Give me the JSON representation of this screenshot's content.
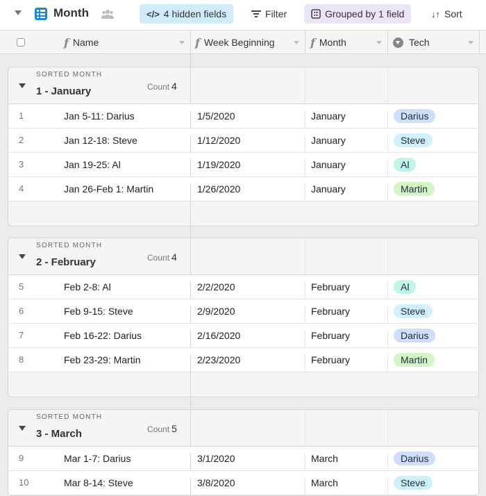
{
  "toolbar": {
    "view_name": "Month",
    "hidden_fields_label": "4 hidden fields",
    "filter_label": "Filter",
    "grouped_label": "Grouped by 1 field",
    "sort_label": "Sort"
  },
  "columns": [
    {
      "label": "Name",
      "icon": "formula-icon"
    },
    {
      "label": "Week Beginning",
      "icon": "formula-icon"
    },
    {
      "label": "Month",
      "icon": "formula-icon"
    },
    {
      "label": "Tech",
      "icon": "single-select-icon"
    }
  ],
  "tech_colors": {
    "Darius": "#cfdffb",
    "Steve": "#d0f0fc",
    "Al": "#c2f5e9",
    "Martin": "#d1f7c4"
  },
  "groups": [
    {
      "label": "SORTED MONTH",
      "value": "1 - January",
      "count_label": "Count",
      "count": "4",
      "rows": [
        {
          "num": "1",
          "name": "Jan 5-11: Darius",
          "week": "1/5/2020",
          "month": "January",
          "tech": "Darius"
        },
        {
          "num": "2",
          "name": "Jan 12-18: Steve",
          "week": "1/12/2020",
          "month": "January",
          "tech": "Steve"
        },
        {
          "num": "3",
          "name": "Jan 19-25: Al",
          "week": "1/19/2020",
          "month": "January",
          "tech": "Al"
        },
        {
          "num": "4",
          "name": "Jan 26-Feb 1: Martin",
          "week": "1/26/2020",
          "month": "January",
          "tech": "Martin"
        }
      ]
    },
    {
      "label": "SORTED MONTH",
      "value": "2 - February",
      "count_label": "Count",
      "count": "4",
      "rows": [
        {
          "num": "5",
          "name": "Feb 2-8: Al",
          "week": "2/2/2020",
          "month": "February",
          "tech": "Al"
        },
        {
          "num": "6",
          "name": "Feb 9-15: Steve",
          "week": "2/9/2020",
          "month": "February",
          "tech": "Steve"
        },
        {
          "num": "7",
          "name": "Feb 16-22: Darius",
          "week": "2/16/2020",
          "month": "February",
          "tech": "Darius"
        },
        {
          "num": "8",
          "name": "Feb 23-29: Martin",
          "week": "2/23/2020",
          "month": "February",
          "tech": "Martin"
        }
      ]
    },
    {
      "label": "SORTED MONTH",
      "value": "3 - March",
      "count_label": "Count",
      "count": "5",
      "rows": [
        {
          "num": "9",
          "name": "Mar 1-7: Darius",
          "week": "3/1/2020",
          "month": "March",
          "tech": "Darius"
        },
        {
          "num": "10",
          "name": "Mar 8-14: Steve",
          "week": "3/8/2020",
          "month": "March",
          "tech": "Steve"
        }
      ]
    }
  ]
}
